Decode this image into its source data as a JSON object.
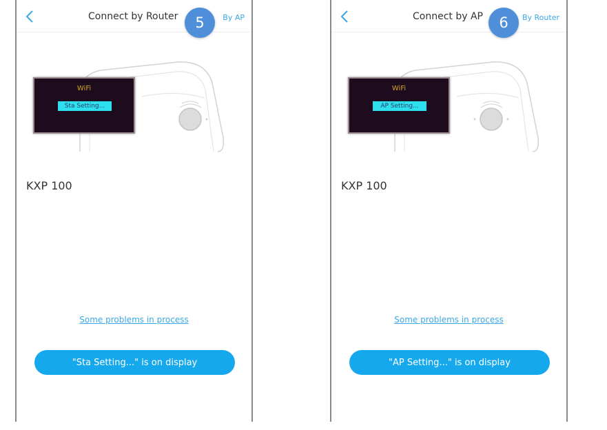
{
  "screens": [
    {
      "title": "Connect by Router",
      "switch_label": "By AP",
      "step": "5",
      "lcd": {
        "label": "WiFi",
        "mode": "Sta Setting..."
      },
      "model": "KXP 100",
      "problems_link": "Some problems in process",
      "confirm_label": "\"Sta Setting...\" is on display"
    },
    {
      "title": "Connect by AP",
      "switch_label": "By Router",
      "step": "6",
      "lcd": {
        "label": "WiFi",
        "mode": "AP Setting..."
      },
      "model": "KXP 100",
      "problems_link": "Some problems in process",
      "confirm_label": "\"AP Setting...\" is on display"
    }
  ],
  "icons": {
    "back": "chevron-left-icon"
  },
  "colors": {
    "accent": "#16a8ec",
    "link": "#3aa8e6",
    "badge": "#4f8fd9",
    "lcd_background": "#1d0c1d",
    "lcd_text": "#d4a52a",
    "lcd_highlight": "#2ee0ee"
  }
}
